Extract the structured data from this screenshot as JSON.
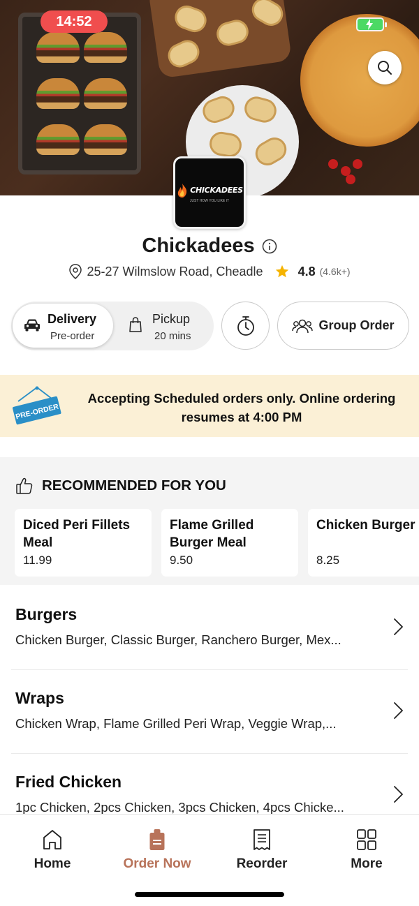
{
  "status_bar": {
    "time": "14:52"
  },
  "restaurant": {
    "name": "Chickadees",
    "logo_text": "CHICKADEES",
    "logo_tagline": "JUST HOW YOU LIKE IT",
    "address": "25-27 Wilmslow Road, Cheadle",
    "rating": "4.8",
    "rating_count": "(4.6k+)"
  },
  "order_mode": {
    "delivery": {
      "label": "Delivery",
      "sub": "Pre-order",
      "selected": true
    },
    "pickup": {
      "label": "Pickup",
      "sub": "20 mins",
      "selected": false
    },
    "group_order_label": "Group Order"
  },
  "banner": {
    "tag": "PRE-ORDER",
    "message": "Accepting Scheduled orders only. Online ordering resumes at 4:00 PM"
  },
  "recommended": {
    "heading": "RECOMMENDED FOR YOU",
    "items": [
      {
        "name": "Diced Peri Fillets Meal",
        "price": "11.99"
      },
      {
        "name": "Flame Grilled Burger Meal",
        "price": "9.50"
      },
      {
        "name": "Chicken Burger Meal",
        "price": "8.25"
      }
    ]
  },
  "categories": [
    {
      "title": "Burgers",
      "desc": "Chicken Burger, Classic Burger, Ranchero Burger, Mex..."
    },
    {
      "title": "Wraps",
      "desc": "Chicken Wrap, Flame Grilled Peri Wrap, Veggie Wrap,..."
    },
    {
      "title": "Fried Chicken",
      "desc": "1pc Chicken, 2pcs Chicken, 3pcs Chicken, 4pcs Chicke..."
    }
  ],
  "bottom_nav": {
    "items": [
      {
        "label": "Home",
        "icon": "home-icon"
      },
      {
        "label": "Order Now",
        "icon": "order-bag-icon",
        "active": true
      },
      {
        "label": "Reorder",
        "icon": "receipt-icon"
      },
      {
        "label": "More",
        "icon": "grid-icon"
      }
    ]
  },
  "colors": {
    "accent": "#b8735a",
    "status_time_bg": "#f04e4e",
    "banner_bg": "#fbf0d6",
    "star": "#f5b301",
    "preorder_tag": "#2a8fc7"
  }
}
